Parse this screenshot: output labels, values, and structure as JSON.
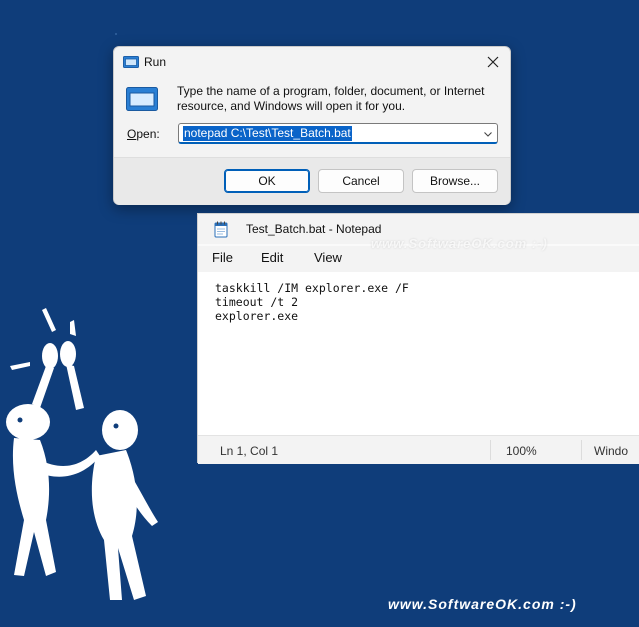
{
  "run_dialog": {
    "title": "Run",
    "description": "Type the name of a program, folder, document, or Internet resource, and Windows will open it for you.",
    "open_label": "Open:",
    "open_value": "notepad C:\\Test\\Test_Batch.bat",
    "ok_label": "OK",
    "cancel_label": "Cancel",
    "browse_label": "Browse..."
  },
  "notepad": {
    "title": "Test_Batch.bat - Notepad",
    "watermark": "www.SoftwareOK.com :-)",
    "menu": {
      "file": "File",
      "edit": "Edit",
      "view": "View"
    },
    "lines": [
      "taskkill /IM explorer.exe /F",
      "timeout /t 2",
      "explorer.exe"
    ],
    "status": {
      "position": "Ln 1, Col 1",
      "zoom": "100%",
      "line_ending": "Windo"
    }
  },
  "footer_watermark": "www.SoftwareOK.com :-)",
  "colors": {
    "background": "#0f3d7a",
    "accent": "#005fb8",
    "selection": "#0a64c9"
  },
  "icons": {
    "run_icon": "run-window-icon",
    "close_icon": "close-icon",
    "chevron": "chevron-down-icon",
    "notepad_icon": "notepad-icon"
  }
}
